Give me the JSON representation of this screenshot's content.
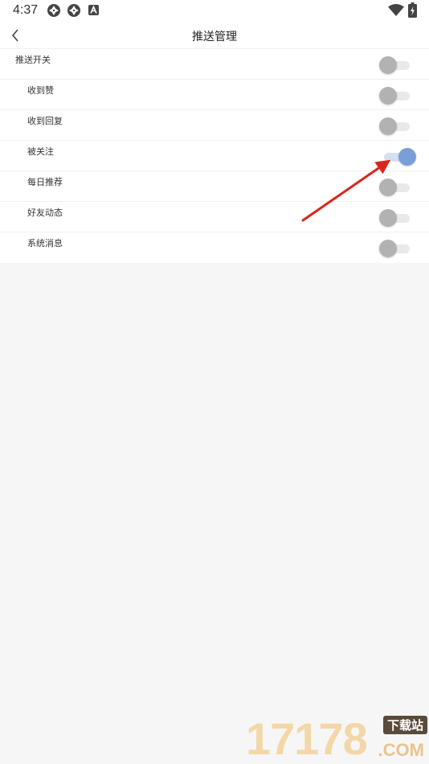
{
  "status_bar": {
    "time": "4:37",
    "icons": [
      "camera-shutter-icon",
      "camera-shutter-icon",
      "app-a-icon",
      "wifi-icon",
      "battery-charging-icon"
    ]
  },
  "nav": {
    "back_icon": "chevron-left-icon",
    "title": "推送管理"
  },
  "settings": {
    "items": [
      {
        "label": "推送开关",
        "enabled": false,
        "level": "master"
      },
      {
        "label": "收到赞",
        "enabled": false,
        "level": "sub"
      },
      {
        "label": "收到回复",
        "enabled": false,
        "level": "sub"
      },
      {
        "label": "被关注",
        "enabled": true,
        "level": "sub"
      },
      {
        "label": "每日推荐",
        "enabled": false,
        "level": "sub"
      },
      {
        "label": "好友动态",
        "enabled": false,
        "level": "sub"
      },
      {
        "label": "系统消息",
        "enabled": false,
        "level": "sub"
      }
    ]
  },
  "annotation": {
    "arrow_color": "#d9261c"
  },
  "watermark": {
    "digits": "17178",
    "badge": "下载站",
    "suffix": ".COM"
  },
  "colors": {
    "toggle_on": "#7a9ed7",
    "toggle_off": "#b2b2b2"
  }
}
